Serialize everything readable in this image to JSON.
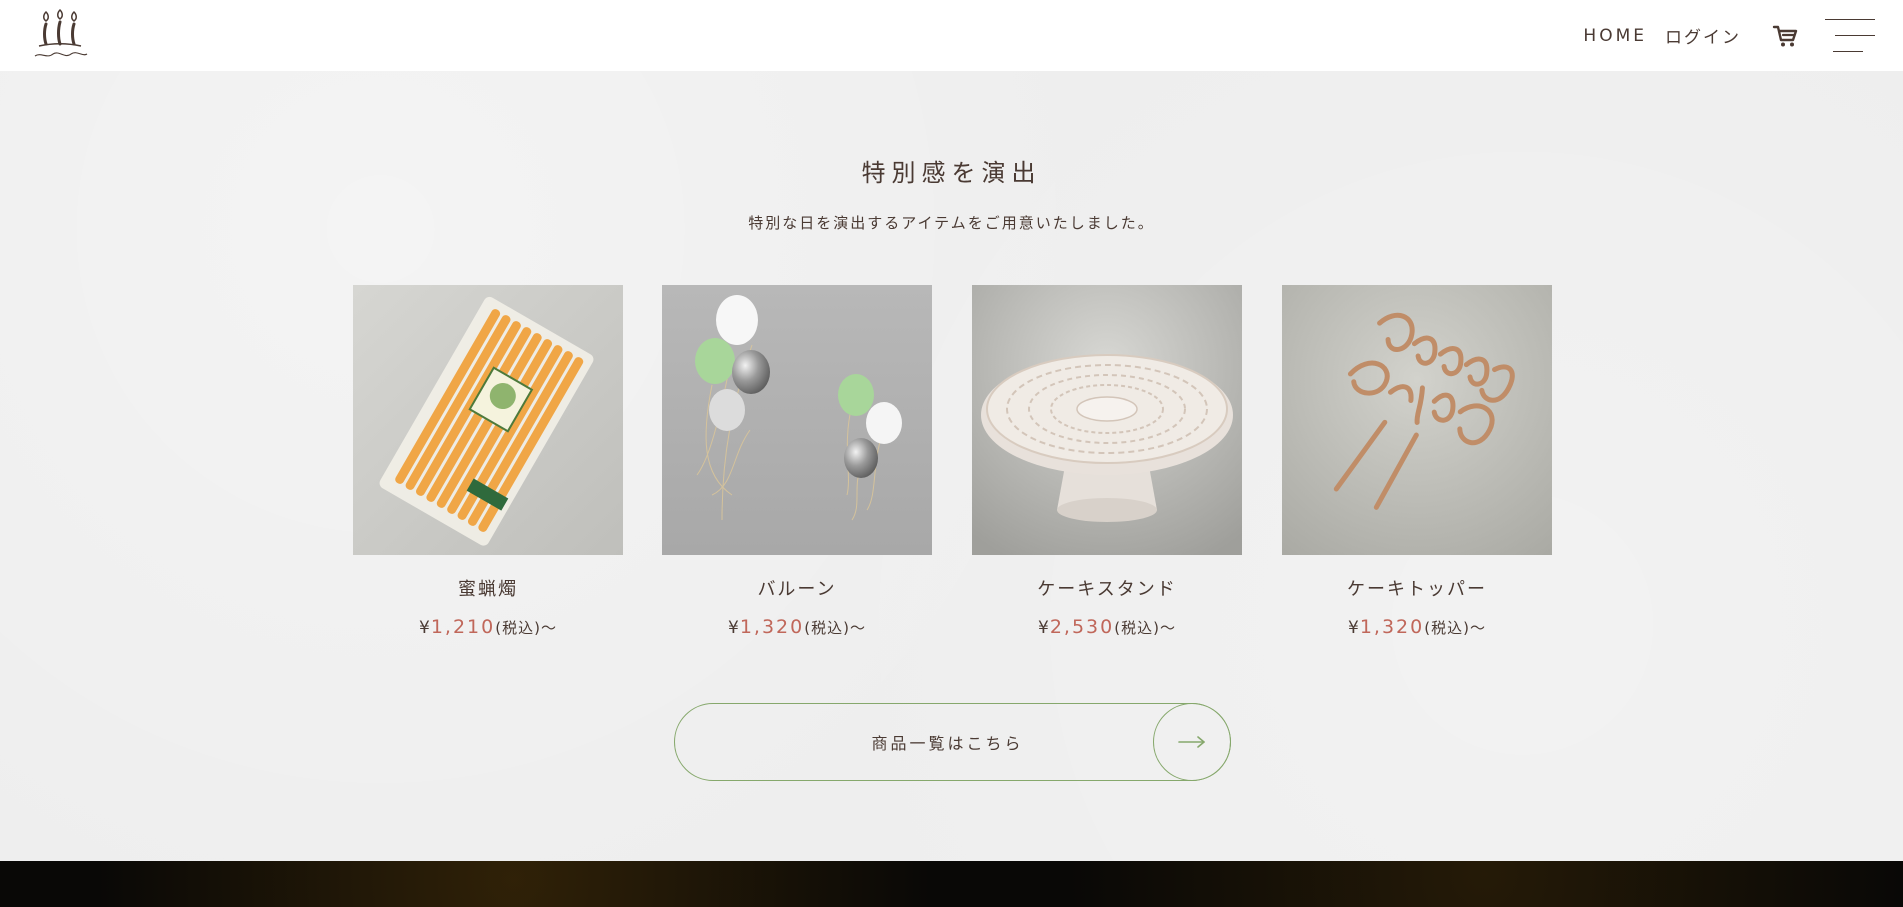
{
  "header": {
    "logo_icon": "birthday-candles-logo",
    "nav": {
      "home": "HOME",
      "login": "ログイン"
    },
    "icons": {
      "cart": "cart-icon",
      "menu": "hamburger-menu-icon"
    }
  },
  "section": {
    "title": "特別感を演出",
    "subtitle": "特別な日を演出するアイテムをご用意いたしました。"
  },
  "products": [
    {
      "name": "蜜蝋燭",
      "price_prefix": "¥",
      "price": "1,210",
      "tax": "(税込)～"
    },
    {
      "name": "バルーン",
      "price_prefix": "¥",
      "price": "1,320",
      "tax": "(税込)～"
    },
    {
      "name": "ケーキスタンド",
      "price_prefix": "¥",
      "price": "2,530",
      "tax": "(税込)～"
    },
    {
      "name": "ケーキトッパー",
      "price_prefix": "¥",
      "price": "1,320",
      "tax": "(税込)～"
    }
  ],
  "cta": {
    "label": "商品一覧はこちら",
    "icon": "arrow-right-icon"
  },
  "colors": {
    "brown": "#4a3a33",
    "price_accent": "#c0675a",
    "cta_border": "#86a86c",
    "bg": "#eeeeee",
    "header_bg": "#ffffff",
    "dark_strip": "#090806"
  }
}
